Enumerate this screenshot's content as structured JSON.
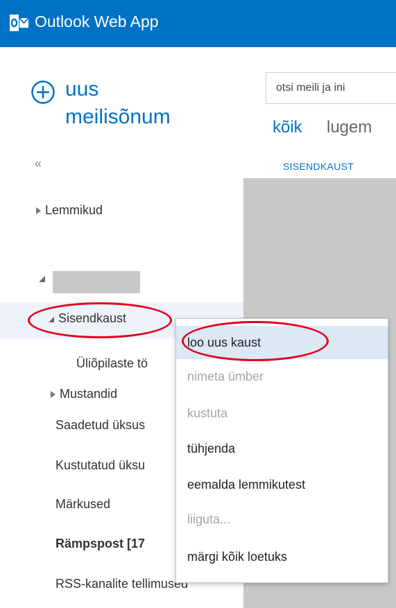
{
  "header": {
    "app_title": "Outlook Web App",
    "brand_color": "#0072c6"
  },
  "new_message": {
    "line1": "uus",
    "line2": "meilisõnum",
    "icon": "plus-circle-icon"
  },
  "search": {
    "placeholder": "otsi meili ja ini"
  },
  "filters": {
    "all": "kõik",
    "read": "lugem"
  },
  "collapse_label": "«",
  "folder_header": "SISENDKAUST",
  "nav": {
    "favorites": "Lemmikud",
    "inbox": "Sisendkaust",
    "subfolder": "Üliõpilaste tö",
    "drafts": "Mustandid",
    "sent": "Saadetud üksus",
    "deleted": "Kustutatud üksu",
    "notes": "Märkused",
    "junk": "Rämpspost  [17",
    "rss": "RSS-kanalite tellimused"
  },
  "context_menu": {
    "items": [
      {
        "label": "loo uus kaust",
        "state": "highlighted"
      },
      {
        "label": "nimeta ümber",
        "state": "disabled"
      },
      {
        "label": "kustuta",
        "state": "disabled"
      },
      {
        "label": "tühjenda",
        "state": "enabled"
      },
      {
        "label": "eemalda lemmikutest",
        "state": "enabled"
      },
      {
        "label": "liiguta...",
        "state": "disabled"
      },
      {
        "label": "märgi kõik loetuks",
        "state": "enabled"
      }
    ]
  },
  "annotation_color": "#e0001b"
}
